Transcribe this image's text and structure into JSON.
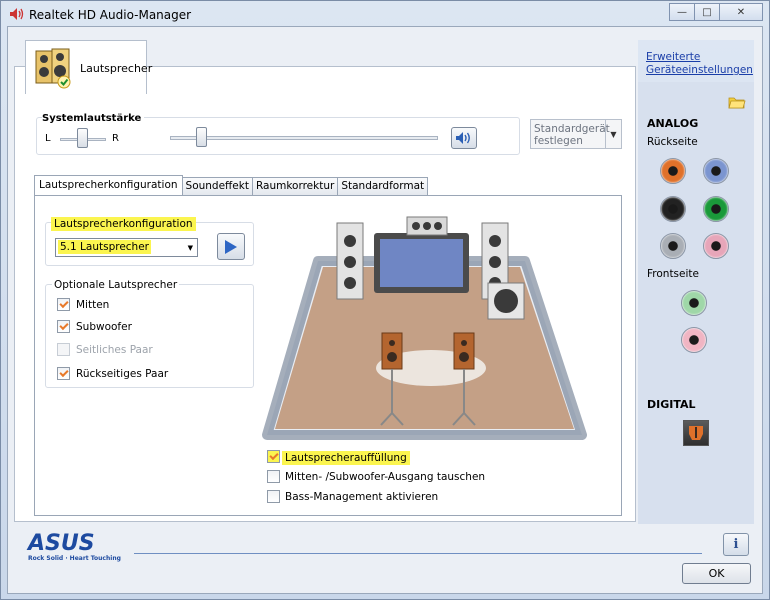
{
  "window": {
    "title": "Realtek HD Audio-Manager",
    "minimize": "—",
    "restore": "□",
    "close": "✕"
  },
  "device_tab": {
    "label": "Lautsprecher"
  },
  "volume": {
    "title": "Systemlautstärke",
    "left_label": "L",
    "right_label": "R",
    "level": 0.12,
    "balance": 0.5
  },
  "default_device": {
    "label": "Standardgerät festlegen"
  },
  "tabs": [
    "Lautsprecherkonfiguration",
    "Soundeffekt",
    "Raumkorrektur",
    "Standardformat"
  ],
  "config": {
    "title": "Lautsprecherkonfiguration",
    "selected": "5.1 Lautsprecher"
  },
  "optional": {
    "title": "Optionale Lautsprecher",
    "items": [
      {
        "label": "Mitten",
        "checked": true,
        "disabled": false
      },
      {
        "label": "Subwoofer",
        "checked": true,
        "disabled": false
      },
      {
        "label": "Seitliches Paar",
        "checked": false,
        "disabled": true
      },
      {
        "label": "Rückseitiges Paar",
        "checked": true,
        "disabled": false
      }
    ]
  },
  "bottom_options": [
    {
      "label": "Lautsprecherauffüllung",
      "checked": true
    },
    {
      "label": "Mitten- /Subwoofer-Ausgang tauschen",
      "checked": false
    },
    {
      "label": "Bass-Management aktivieren",
      "checked": false
    }
  ],
  "sidebar": {
    "advanced_link": [
      "Erweiterte",
      "Geräteeinstellungen"
    ],
    "analog_title": "ANALOG",
    "back_label": "Rückseite",
    "front_label": "Frontseite",
    "digital_title": "DIGITAL",
    "back_jacks": [
      "#e0712a",
      "#7b95d0",
      "#222222",
      "#1a9a3a",
      "#a9aeb5",
      "#e7a6b9"
    ],
    "front_jacks": [
      "#9fd7a8",
      "#f0b5c3"
    ]
  },
  "footer": {
    "brand": "ASUS",
    "tagline": "Rock Solid · Heart Touching",
    "ok": "OK",
    "info": "i"
  },
  "colors": {
    "highlight": "#fbf54f",
    "check": "#e8792a",
    "link": "#1a3ea8"
  }
}
